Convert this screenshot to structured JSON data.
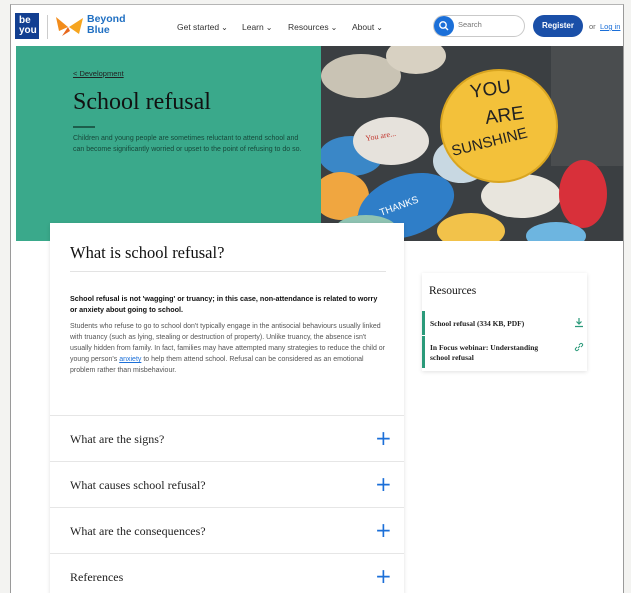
{
  "header": {
    "logo_be": "be",
    "logo_you": "you",
    "logo_bb_line1": "Beyond",
    "logo_bb_line2": "Blue",
    "nav": [
      "Get started",
      "Learn",
      "Resources",
      "About"
    ],
    "search_placeholder": "Search",
    "register_label": "Register",
    "or_text": "or",
    "login_label": "Log in"
  },
  "hero": {
    "breadcrumb": "< Development",
    "title": "School refusal",
    "description": "Children and young people are sometimes reluctant to attend school and can become significantly worried or upset to the point of refusing to do so.",
    "image_text": [
      "YOU",
      "ARE",
      "SUNSHINE",
      "THANKS",
      "You are..."
    ]
  },
  "main": {
    "title": "What is school refusal?",
    "lead": "School refusal is not 'wagging' or truancy; in this case, non-attendance is related to worry or anxiety about going to school.",
    "body_before_link": "Students who refuse to go to school don't typically engage in the antisocial behaviours usually linked with truancy (such as lying, stealing or destruction of property). Unlike truancy, the absence isn't usually hidden from family. In fact, families may have attempted many strategies to reduce the child or young person's ",
    "body_link": "anxiety",
    "body_after_link": " to help them attend school. Refusal can be considered as an emotional problem rather than misbehaviour.",
    "accordions": [
      "What are the signs?",
      "What causes school refusal?",
      "What are the consequences?",
      "References"
    ],
    "plus_glyph": "+"
  },
  "resources": {
    "title": "Resources",
    "items": [
      {
        "label": "School refusal (334 KB, PDF)",
        "icon": "download-icon"
      },
      {
        "label": "In Focus webinar: Understanding school refusal",
        "icon": "link-icon"
      }
    ]
  },
  "colors": {
    "hero_green": "#3aa98b",
    "brand_blue": "#1b6fd8",
    "register_blue": "#1a4fa8"
  }
}
